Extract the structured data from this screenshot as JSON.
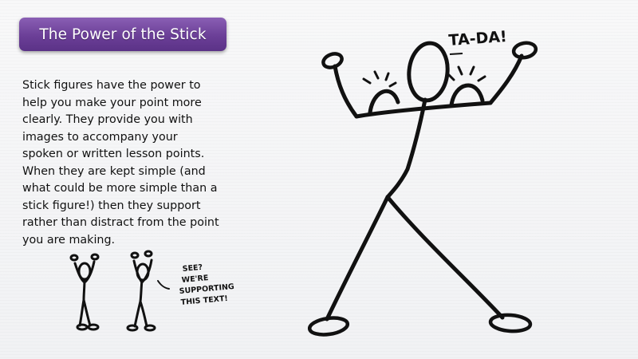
{
  "slide": {
    "title": "The Power of the Stick",
    "body": "Stick figures have the power to help you make your point more clearly. They provide you with images to accompany your spoken or written lesson points. When they are kept simple (and what could be more simple than a stick figure!) then they support rather than distract from the point you are making."
  },
  "illustration": {
    "big_figure_caption": "TA-DA!",
    "small_figures_speech": [
      "SEE?",
      "WE'RE",
      "SUPPORTING",
      "THIS TEXT!"
    ]
  },
  "colors": {
    "title_bar": "#6b3f97",
    "ink": "#111111"
  }
}
